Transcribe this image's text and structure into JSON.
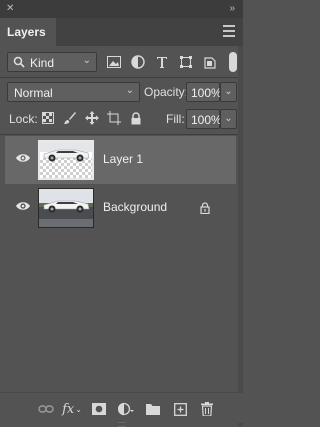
{
  "panel": {
    "tab_label": "Layers",
    "close_glyph": "✕",
    "collapse_glyph": "»",
    "menu_icon": "hamburger-menu-icon"
  },
  "filter": {
    "kind_label": "Kind",
    "search_icon": "search-icon",
    "dropdown_glyph": "⌄",
    "icons": [
      "image-filter-icon",
      "adjustment-filter-icon",
      "type-filter-icon",
      "shape-filter-icon",
      "smart-object-filter-icon"
    ]
  },
  "blend": {
    "mode": "Normal",
    "opacity_label": "Opacity:",
    "opacity_value": "100%",
    "lock_label": "Lock:",
    "fill_label": "Fill:",
    "fill_value": "100%",
    "lock_icons": [
      "lock-transparent-pixels-icon",
      "lock-image-pixels-icon",
      "lock-position-icon",
      "lock-artboard-icon",
      "lock-all-icon"
    ]
  },
  "layers": [
    {
      "name": "Layer 1",
      "selected": true,
      "visible": true,
      "locked": false
    },
    {
      "name": "Background",
      "selected": false,
      "visible": true,
      "locked": true
    }
  ],
  "bottom_icons": [
    "link-layers-icon",
    "fx-icon",
    "add-mask-icon",
    "new-adjustment-icon",
    "new-group-icon",
    "new-layer-icon",
    "trash-icon"
  ],
  "fx_label": "fx",
  "colors": {
    "panel": "#535353",
    "selected_row": "#686868",
    "topbar": "#3c3c3c"
  }
}
